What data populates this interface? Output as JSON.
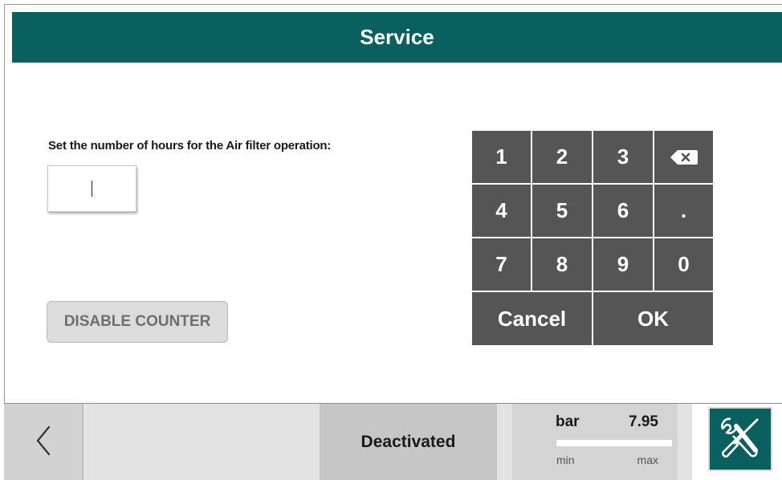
{
  "header": {
    "title": "Service"
  },
  "form": {
    "prompt": "Set the number of hours for the Air filter operation:",
    "hours_value": ""
  },
  "buttons": {
    "disable_counter": "DISABLE COUNTER"
  },
  "keypad": {
    "k1": "1",
    "k2": "2",
    "k3": "3",
    "k4": "4",
    "k5": "5",
    "k6": "6",
    "kdot": ".",
    "k7": "7",
    "k8": "8",
    "k9": "9",
    "k0": "0",
    "cancel": "Cancel",
    "ok": "OK",
    "backspace_icon": "backspace-icon"
  },
  "footer": {
    "back_icon": "chevron-left-icon",
    "status": "Deactivated",
    "pressure": {
      "unit": "bar",
      "value": "7.95",
      "min_label": "min",
      "max_label": "max"
    },
    "tools_icon": "wrench-screwdriver-icon"
  },
  "colors": {
    "accent": "#0a5f5f",
    "key_bg": "#555555"
  }
}
